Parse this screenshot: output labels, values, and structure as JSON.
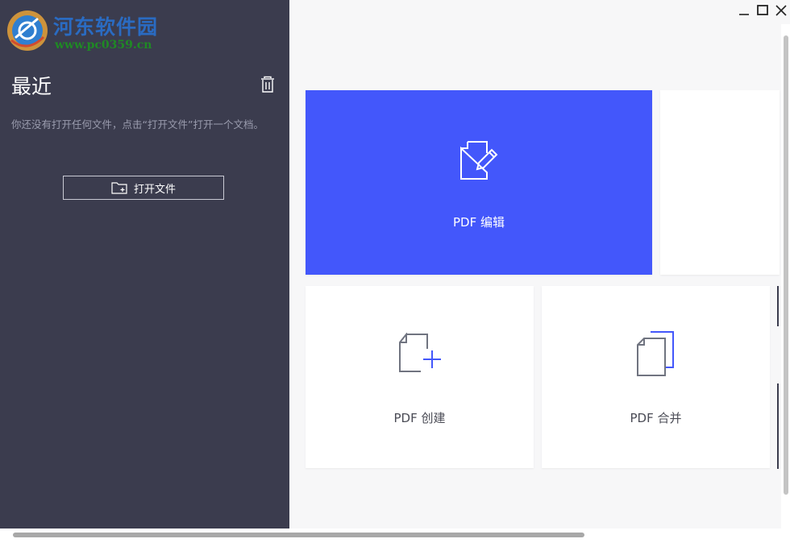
{
  "watermark": {
    "title": "河东软件园",
    "url": "www.pc0359.cn",
    "logo_icon": "gear-logo-icon"
  },
  "sidebar": {
    "title": "最近",
    "empty_hint": "你还没有打开任何文件，点击“打开文件”打开一个文档。",
    "open_button_label": "打开文件",
    "delete_icon": "trash-icon",
    "open_icon": "folder-plus-icon"
  },
  "window_controls": {
    "minimize_icon": "minimize-icon",
    "maximize_icon": "maximize-icon",
    "close_icon": "close-icon"
  },
  "cards": {
    "edit": {
      "label": "PDF 编辑",
      "icon": "document-pencil-icon"
    },
    "create": {
      "label": "PDF 创建",
      "icon": "document-plus-icon"
    },
    "merge": {
      "label": "PDF 合并",
      "icon": "documents-stack-icon"
    }
  },
  "colors": {
    "sidebar_bg": "#3b3c4e",
    "accent": "#4357fb",
    "content_bg": "#f7f7f8",
    "watermark_title": "#2a6bc2",
    "watermark_url": "#1f8a24"
  }
}
